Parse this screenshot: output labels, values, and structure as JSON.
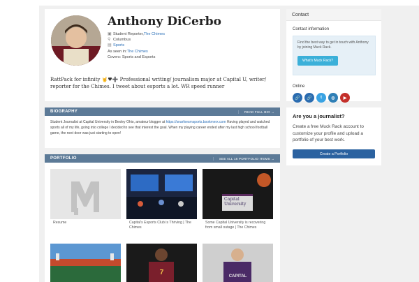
{
  "profile": {
    "name": "Anthony DiCerbo",
    "role": "Student Reporter, ",
    "role_outlet": "The Chimes",
    "location": "Columbus",
    "beat": "Sports",
    "seen_in_label": "As seen in: ",
    "seen_in": "The Chimes",
    "covers": "Covers:  Sports and Esports",
    "bio": "RattPack for infinity 🤘♥➕ Professional writing/ journalism major at Capital U, writer/ reporter for the Chimes. I tweet about esports a lot. WR speed runner"
  },
  "contact": {
    "header": "Contact",
    "info_title": "Contact information",
    "info_text": "Find the best way to get in touch with Anthony by joining Muck Rack.",
    "button": "What's Muck Rack?",
    "online_label": "Online",
    "socials": [
      {
        "name": "link",
        "glyph": "🔗",
        "color": "#2b6cb0"
      },
      {
        "name": "link",
        "glyph": "🔗",
        "color": "#2b6cb0"
      },
      {
        "name": "twitter",
        "glyph": "t",
        "color": "#3aa3e3"
      },
      {
        "name": "instagram",
        "glyph": "◎",
        "color": "#2f7fb6"
      },
      {
        "name": "youtube",
        "glyph": "▶",
        "color": "#c4302b"
      }
    ]
  },
  "journalist": {
    "title": "Are you a journalist?",
    "text": "Create a free Muck Rack account to customize your profile and upload a portfolio of your best work.",
    "button": "Create a Portfolio"
  },
  "biography": {
    "title": "BIOGRAPHY",
    "link": "READ FULL BIO →",
    "text_a": "Student Journalist at Capital University in Bexley Ohio, amateur blogger at ",
    "text_link": "https://snarfxesmsports.bookmerx.com",
    "text_b": " Having played and watched sports all of my life, going into college I decided to see that interest the goal. When my playing career ended after my last high school football game, the next door was just starting to open!"
  },
  "portfolio": {
    "title": "PORTFOLIO",
    "link": "SEE ALL 16 PORTFOLIO ITEMS →",
    "items": [
      {
        "caption": "Resume"
      },
      {
        "caption": "Capital's Esports Club is Thriving | The Chimes"
      },
      {
        "caption": "Some Capital University is recovering from small outage | The Chimes"
      },
      {
        "caption": ""
      },
      {
        "caption": ""
      },
      {
        "caption": ""
      }
    ],
    "thumb_texts": {
      "capital_university": "Capital University",
      "cavaliers_number": "7",
      "jersey_text": "CAPITAL"
    }
  }
}
